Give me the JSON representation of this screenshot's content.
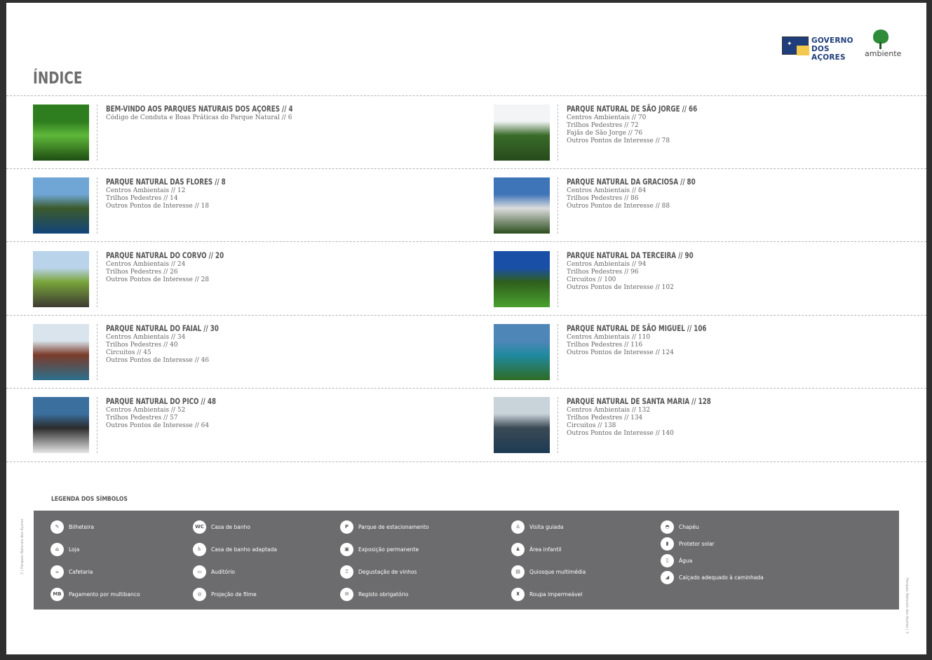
{
  "header": {
    "gov_logo_line1": "GOVERNO",
    "gov_logo_line2": "DOS AÇORES",
    "ambiente_logo": "ambiente",
    "title": "ÍNDICE"
  },
  "entries": [
    {
      "heading": "BEM-VINDO AOS PARQUES NATURAIS DOS AÇORES // 4",
      "items": [
        "Código de Conduta e Boas Práticas do Parque Natural // 6"
      ],
      "colors": [
        "#2e7d1f",
        "#5fb83a",
        "#1e4d12"
      ]
    },
    {
      "heading": "PARQUE NATURAL DE SÃO JORGE // 66",
      "items": [
        "Centros Ambientais // 70",
        "Trilhos Pedestres // 72",
        "Fajãs de São Jorge // 76",
        "Outros Pontos de Interesse // 78"
      ],
      "colors": [
        "#f2f4f6",
        "#3a6b2a",
        "#274a1c"
      ]
    },
    {
      "heading": "PARQUE NATURAL DAS FLORES // 8",
      "items": [
        "Centros Ambientais // 12",
        "Trilhos Pedestres // 14",
        "Outros Pontos de Interesse // 18"
      ],
      "colors": [
        "#6fa6d6",
        "#3b5a2c",
        "#12447a"
      ]
    },
    {
      "heading": "PARQUE NATURAL DA GRACIOSA // 80",
      "items": [
        "Centros Ambientais // 84",
        "Trilhos Pedestres // 86",
        "Outros Pontos de Interesse // 88"
      ],
      "colors": [
        "#3e74b8",
        "#dcdcdc",
        "#2b4d1e"
      ]
    },
    {
      "heading": "PARQUE NATURAL DO CORVO // 20",
      "items": [
        "Centros Ambientais // 24",
        "Trilhos Pedestres // 26",
        "Outros Pontos de Interesse // 28"
      ],
      "colors": [
        "#b9d3ea",
        "#79a43a",
        "#3d3a32"
      ]
    },
    {
      "heading": "PARQUE NATURAL DA TERCEIRA // 90",
      "items": [
        "Centros Ambientais // 94",
        "Trilhos Pedestres // 96",
        "Circuitos // 100",
        "Outros Pontos de Interesse // 102"
      ],
      "colors": [
        "#1a4fa8",
        "#2f5e1c",
        "#49a12f"
      ]
    },
    {
      "heading": "PARQUE NATURAL DO FAIAL // 30",
      "items": [
        "Centros Ambientais // 34",
        "Trilhos Pedestres // 40",
        "Circuitos // 45",
        "Outros Pontos de Interesse // 46"
      ],
      "colors": [
        "#d9e4ec",
        "#7a3b2a",
        "#2a6f8c"
      ]
    },
    {
      "heading": "PARQUE NATURAL DE SÃO MIGUEL // 106",
      "items": [
        "Centros Ambientais // 110",
        "Trilhos Pedestres // 116",
        "Outros Pontos de Interesse // 124"
      ],
      "colors": [
        "#4f86b8",
        "#1f8aa0",
        "#2f6b24"
      ]
    },
    {
      "heading": "PARQUE NATURAL DO PICO // 48",
      "items": [
        "Centros Ambientais // 52",
        "Trilhos Pedestres // 57",
        "Outros Pontos de Interesse // 64"
      ],
      "colors": [
        "#3a6f9e",
        "#2b2b2b",
        "#e6e6e6"
      ]
    },
    {
      "heading": "PARQUE NATURAL DE SANTA MARIA // 128",
      "items": [
        "Centros Ambientais // 132",
        "Trilhos Pedestres // 134",
        "Circuitos // 138",
        "Outros Pontos de Interesse // 140"
      ],
      "colors": [
        "#c9d3da",
        "#3a4a55",
        "#1d3a52"
      ]
    }
  ],
  "legend": {
    "title": "LEGENDA DOS SÍMBOLOS",
    "items": [
      {
        "label": "Bilheteira",
        "icon": "ticket-icon",
        "glyph": "✎"
      },
      {
        "label": "Loja",
        "icon": "basket-icon",
        "glyph": "⌂"
      },
      {
        "label": "Cafetaria",
        "icon": "coffee-icon",
        "glyph": "☕"
      },
      {
        "label": "Pagamento por multibanco",
        "icon": "mb-card-icon",
        "glyph": "MB"
      },
      {
        "label": "Casa de banho",
        "icon": "wc-icon",
        "glyph": "WC"
      },
      {
        "label": "Casa de banho adaptada",
        "icon": "wc-accessible-icon",
        "glyph": "♿"
      },
      {
        "label": "Auditório",
        "icon": "auditorium-icon",
        "glyph": "▭"
      },
      {
        "label": "Projeção de filme",
        "icon": "film-icon",
        "glyph": "◎"
      },
      {
        "label": "Parque de estacionamento",
        "icon": "parking-icon",
        "glyph": "P"
      },
      {
        "label": "Exposição permanente",
        "icon": "exhibition-icon",
        "glyph": "▣"
      },
      {
        "label": "Degustação de vinhos",
        "icon": "wine-icon",
        "glyph": "♖"
      },
      {
        "label": "Registo obrigatório",
        "icon": "register-icon",
        "glyph": "✉"
      },
      {
        "label": "Visita guiada",
        "icon": "guided-visit-icon",
        "glyph": "♙"
      },
      {
        "label": "Área infantil",
        "icon": "kids-area-icon",
        "glyph": "♟"
      },
      {
        "label": "Quiosque multimédia",
        "icon": "kiosk-icon",
        "glyph": "▤"
      },
      {
        "label": "Roupa impermeável",
        "icon": "raincoat-icon",
        "glyph": "♜"
      },
      {
        "label": "Chapéu",
        "icon": "hat-icon",
        "glyph": "◓"
      },
      {
        "label": "Protetor solar",
        "icon": "sunscreen-icon",
        "glyph": "▮"
      },
      {
        "label": "Água",
        "icon": "water-bottle-icon",
        "glyph": "▯"
      },
      {
        "label": "Calçado adequado à caminhada",
        "icon": "hiking-shoe-icon",
        "glyph": "◢"
      }
    ]
  },
  "sidebar": {
    "left": "2 | Parques Naturais dos Açores",
    "right": "Parques Naturais dos Açores | 3"
  }
}
